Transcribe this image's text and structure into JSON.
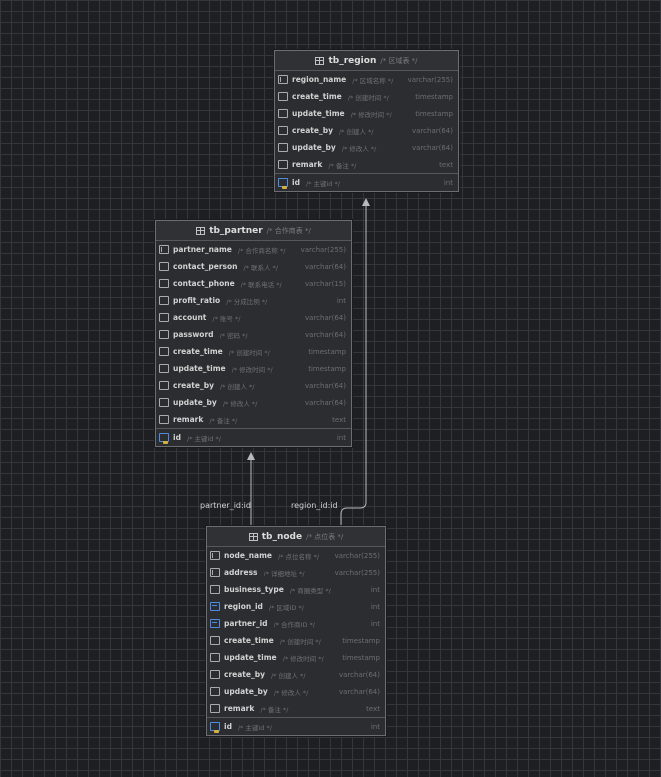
{
  "tables": {
    "tb_region": {
      "name": "tb_region",
      "comment": "/* 区域表 */",
      "columns": [
        {
          "name": "region_name",
          "comment": "/* 区域名称 */",
          "type": "varchar(255)",
          "icon": "index-icon"
        },
        {
          "name": "create_time",
          "comment": "/* 创建时间 */",
          "type": "timestamp",
          "icon": "column-icon"
        },
        {
          "name": "update_time",
          "comment": "/* 修改时间 */",
          "type": "timestamp",
          "icon": "column-icon"
        },
        {
          "name": "create_by",
          "comment": "/* 创建人 */",
          "type": "varchar(64)",
          "icon": "column-icon"
        },
        {
          "name": "update_by",
          "comment": "/* 修改人 */",
          "type": "varchar(64)",
          "icon": "column-icon"
        },
        {
          "name": "remark",
          "comment": "/* 备注 */",
          "type": "text",
          "icon": "column-icon"
        }
      ],
      "pk": {
        "name": "id",
        "comment": "/* 主键id */",
        "type": "int",
        "icon": "primary-key-icon"
      }
    },
    "tb_partner": {
      "name": "tb_partner",
      "comment": "/* 合作商表 */",
      "columns": [
        {
          "name": "partner_name",
          "comment": "/* 合作商名称 */",
          "type": "varchar(255)",
          "icon": "index-icon"
        },
        {
          "name": "contact_person",
          "comment": "/* 联系人 */",
          "type": "varchar(64)",
          "icon": "column-icon"
        },
        {
          "name": "contact_phone",
          "comment": "/* 联系电话 */",
          "type": "varchar(15)",
          "icon": "column-icon"
        },
        {
          "name": "profit_ratio",
          "comment": "/* 分成比例 */",
          "type": "int",
          "icon": "column-icon"
        },
        {
          "name": "account",
          "comment": "/* 账号 */",
          "type": "varchar(64)",
          "icon": "column-icon"
        },
        {
          "name": "password",
          "comment": "/* 密码 */",
          "type": "varchar(64)",
          "icon": "column-icon"
        },
        {
          "name": "create_time",
          "comment": "/* 创建时间 */",
          "type": "timestamp",
          "icon": "column-icon"
        },
        {
          "name": "update_time",
          "comment": "/* 修改时间 */",
          "type": "timestamp",
          "icon": "column-icon"
        },
        {
          "name": "create_by",
          "comment": "/* 创建人 */",
          "type": "varchar(64)",
          "icon": "column-icon"
        },
        {
          "name": "update_by",
          "comment": "/* 修改人 */",
          "type": "varchar(64)",
          "icon": "column-icon"
        },
        {
          "name": "remark",
          "comment": "/* 备注 */",
          "type": "text",
          "icon": "column-icon"
        }
      ],
      "pk": {
        "name": "id",
        "comment": "/* 主键id */",
        "type": "int",
        "icon": "primary-key-icon"
      }
    },
    "tb_node": {
      "name": "tb_node",
      "comment": "/* 点位表 */",
      "columns": [
        {
          "name": "node_name",
          "comment": "/* 点位名称 */",
          "type": "varchar(255)",
          "icon": "index-icon"
        },
        {
          "name": "address",
          "comment": "/* 详细地址 */",
          "type": "varchar(255)",
          "icon": "index-icon"
        },
        {
          "name": "business_type",
          "comment": "/* 商圈类型 */",
          "type": "int",
          "icon": "column-icon"
        },
        {
          "name": "region_id",
          "comment": "/* 区域ID */",
          "type": "int",
          "icon": "foreign-key-icon"
        },
        {
          "name": "partner_id",
          "comment": "/* 合作商ID */",
          "type": "int",
          "icon": "foreign-key-icon"
        },
        {
          "name": "create_time",
          "comment": "/* 创建时间 */",
          "type": "timestamp",
          "icon": "column-icon"
        },
        {
          "name": "update_time",
          "comment": "/* 修改时间 */",
          "type": "timestamp",
          "icon": "column-icon"
        },
        {
          "name": "create_by",
          "comment": "/* 创建人 */",
          "type": "varchar(64)",
          "icon": "column-icon"
        },
        {
          "name": "update_by",
          "comment": "/* 修改人 */",
          "type": "varchar(64)",
          "icon": "column-icon"
        },
        {
          "name": "remark",
          "comment": "/* 备注 */",
          "type": "text",
          "icon": "column-icon"
        }
      ],
      "pk": {
        "name": "id",
        "comment": "/* 主键id */",
        "type": "int",
        "icon": "primary-key-icon"
      }
    }
  },
  "relations": [
    {
      "label": "partner_id:id",
      "from": "tb_node",
      "to": "tb_partner"
    },
    {
      "label": "region_id:id",
      "from": "tb_node",
      "to": "tb_region"
    }
  ]
}
